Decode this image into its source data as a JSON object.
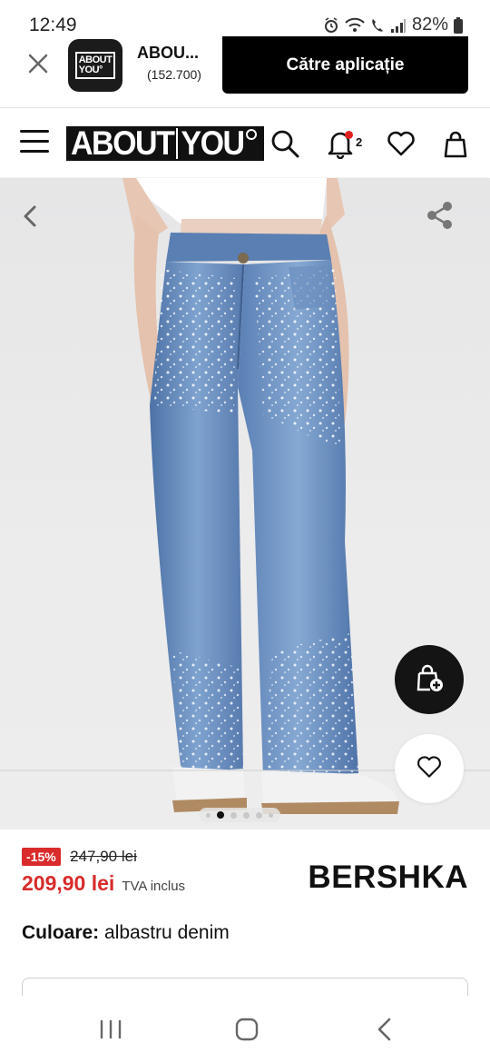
{
  "status_bar": {
    "time": "12:49",
    "battery": "82%"
  },
  "app_banner": {
    "app_icon_line1": "ABOUT",
    "app_icon_line2": "YOU°",
    "title": "ABOU...",
    "subtitle": "(152.700)",
    "cta_label": "Către aplicație"
  },
  "header": {
    "logo_left": "ABOUT",
    "logo_right": "YOU",
    "notification_count": "2",
    "icons": [
      "menu-icon",
      "search-icon",
      "bell-icon",
      "heart-icon",
      "bag-icon"
    ]
  },
  "product": {
    "image_index": 1,
    "image_count": 5,
    "discount": "-15%",
    "old_price": "247,90 lei",
    "price": "209,90 lei",
    "vat_note": "TVA inclus",
    "brand": "BERSHKA",
    "color_label": "Culoare:",
    "color_value": "albastru denim"
  },
  "colors": {
    "accent_red": "#d92b2b",
    "black": "#000000",
    "denim": "#5f86b8"
  }
}
